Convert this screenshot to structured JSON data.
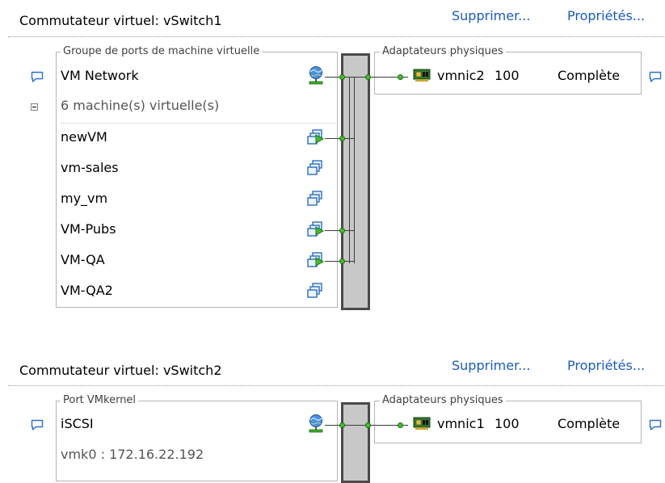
{
  "switches": [
    {
      "title": "Commutateur virtuel: vSwitch1",
      "remove_label": "Supprimer...",
      "props_label": "Propriétés...",
      "portgroup": {
        "legend": "Groupe de ports de machine virtuelle",
        "name": "VM Network",
        "vm_count_label": "6 machine(s) virtuelle(s)",
        "vms": [
          {
            "name": "newVM",
            "powered_on": true
          },
          {
            "name": "vm-sales",
            "powered_on": false
          },
          {
            "name": "my_vm",
            "powered_on": false
          },
          {
            "name": "VM-Pubs",
            "powered_on": true
          },
          {
            "name": "VM-QA",
            "powered_on": true
          },
          {
            "name": "VM-QA2",
            "powered_on": false
          }
        ]
      },
      "adapters": {
        "legend": "Adaptateurs physiques",
        "nic": "vmnic2",
        "speed": "100",
        "duplex": "Complète"
      }
    },
    {
      "title": "Commutateur virtuel: vSwitch2",
      "remove_label": "Supprimer...",
      "props_label": "Propriétés...",
      "vmkernel": {
        "legend": "Port VMkernel",
        "name": "iSCSI",
        "address": "vmk0 : 172.16.22.192"
      },
      "adapters": {
        "legend": "Adaptateurs physiques",
        "nic": "vmnic1",
        "speed": "100",
        "duplex": "Complète"
      }
    }
  ],
  "icons": {
    "comment": "speech-bubble-icon",
    "network": "network-globe-icon",
    "vm_on": "vm-powered-on-icon",
    "vm_off": "vm-icon",
    "nic": "network-card-icon",
    "collapse": "collapse-minus-icon"
  },
  "colors": {
    "link": "#1a5bc6",
    "port_dot": "#3fbf2a",
    "switch_bar": "#c8c8c8"
  }
}
